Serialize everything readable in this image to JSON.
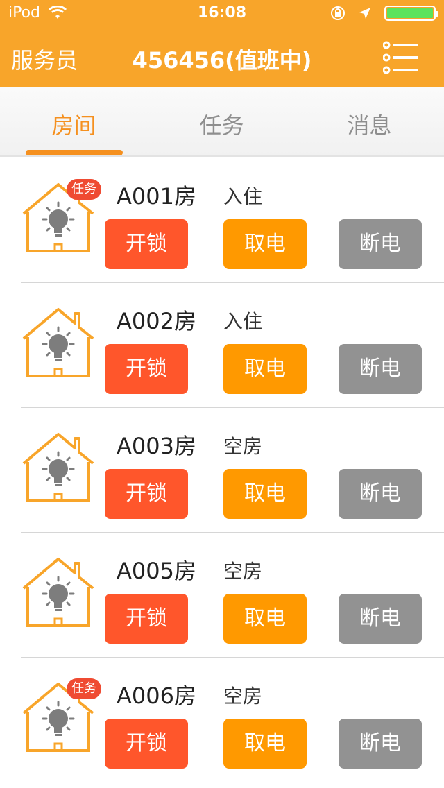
{
  "status_bar": {
    "device": "iPod",
    "time": "16:08"
  },
  "nav": {
    "role": "服务员",
    "title": "456456(值班中)"
  },
  "tabs": [
    {
      "label": "房间",
      "active": true
    },
    {
      "label": "任务",
      "active": false
    },
    {
      "label": "消息",
      "active": false
    }
  ],
  "colors": {
    "brand": "#f8a52a",
    "accent": "#f5901f",
    "unlock": "#ff562b",
    "power_on": "#ff9900",
    "power_off": "#929292",
    "badge": "#ef4b32"
  },
  "rooms": [
    {
      "name": "A001房",
      "status": "入住",
      "badge": "任务",
      "unlock": "开锁",
      "power_on": "取电",
      "power_off": "断电"
    },
    {
      "name": "A002房",
      "status": "入住",
      "badge": "",
      "unlock": "开锁",
      "power_on": "取电",
      "power_off": "断电"
    },
    {
      "name": "A003房",
      "status": "空房",
      "badge": "",
      "unlock": "开锁",
      "power_on": "取电",
      "power_off": "断电"
    },
    {
      "name": "A005房",
      "status": "空房",
      "badge": "",
      "unlock": "开锁",
      "power_on": "取电",
      "power_off": "断电"
    },
    {
      "name": "A006房",
      "status": "空房",
      "badge": "任务",
      "unlock": "开锁",
      "power_on": "取电",
      "power_off": "断电"
    }
  ]
}
